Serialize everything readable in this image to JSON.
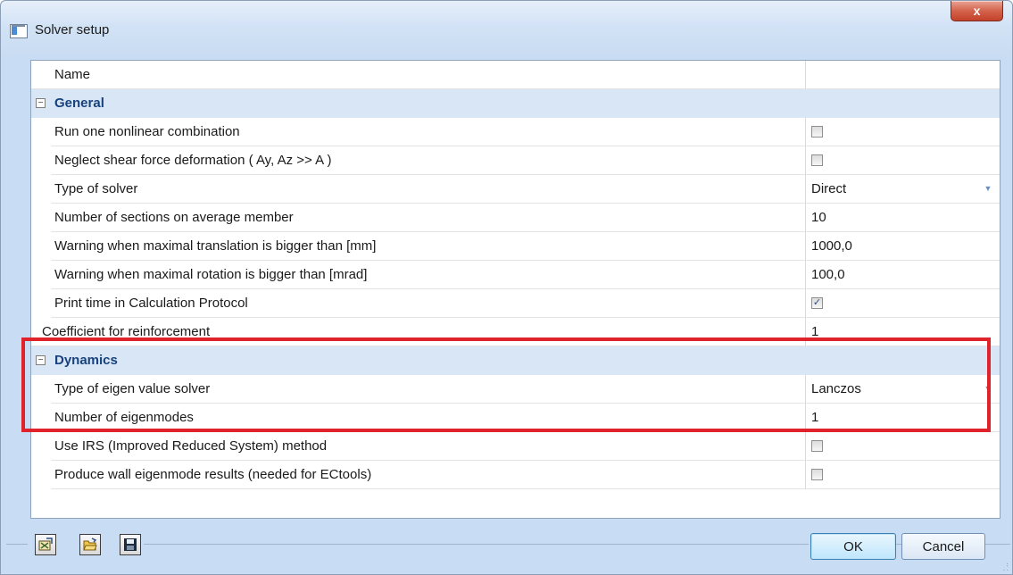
{
  "window": {
    "title": "Solver setup",
    "close_label": "x"
  },
  "grid": {
    "name_header": "Name",
    "sections": {
      "general": {
        "title": "General",
        "expander": "−",
        "rows": [
          {
            "label": "Run one nonlinear combination",
            "type": "checkbox",
            "checked": false
          },
          {
            "label": "Neglect shear force deformation ( Ay, Az >> A )",
            "type": "checkbox",
            "checked": false
          },
          {
            "label": "Type of solver",
            "type": "dropdown",
            "value": "Direct"
          },
          {
            "label": "Number of sections on average member",
            "type": "text",
            "value": "10"
          },
          {
            "label": "Warning when maximal translation is bigger than [mm]",
            "type": "text",
            "value": "1000,0"
          },
          {
            "label": "Warning when maximal rotation is bigger than [mrad]",
            "type": "text",
            "value": "100,0"
          },
          {
            "label": "Print time in Calculation Protocol",
            "type": "checkbox",
            "checked": true
          }
        ]
      },
      "coefficient": {
        "label": "Coefficient for reinforcement",
        "value": "1"
      },
      "dynamics": {
        "title": "Dynamics",
        "expander": "−",
        "rows": [
          {
            "label": "Type of eigen value solver",
            "type": "dropdown",
            "value": "Lanczos"
          },
          {
            "label": "Number of eigenmodes",
            "type": "text",
            "value": "1"
          },
          {
            "label": "Use IRS (Improved Reduced System) method",
            "type": "checkbox",
            "checked": false
          },
          {
            "label": "Produce wall eigenmode results (needed for ECtools)",
            "type": "checkbox",
            "checked": false
          }
        ]
      }
    },
    "check_mark": "✓",
    "dropdown_arrow": "▼"
  },
  "footer": {
    "icons": [
      "export-icon",
      "open-folder-icon",
      "save-icon"
    ],
    "ok_label": "OK",
    "cancel_label": "Cancel"
  },
  "colors": {
    "section_bg": "#d9e6f5",
    "section_text": "#17427e",
    "highlight": "#e0232b",
    "window_frame": "#c8dcf3"
  }
}
